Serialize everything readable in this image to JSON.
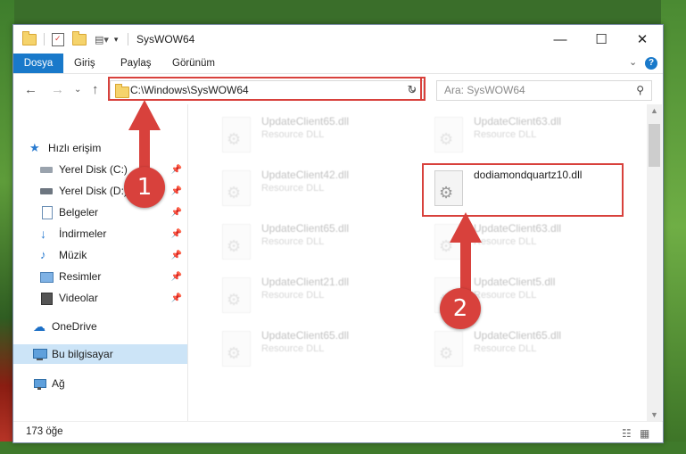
{
  "window": {
    "title": "SysWOW64",
    "min": "—",
    "max": "☐",
    "close": "✕"
  },
  "ribbon": {
    "tabs": [
      {
        "label": "Dosya",
        "active": true
      },
      {
        "label": "Giriş"
      },
      {
        "label": "Paylaş"
      },
      {
        "label": "Görünüm"
      }
    ],
    "expand": "⌄",
    "help": "?"
  },
  "address": {
    "path": "C:\\Windows\\SysWOW64",
    "dropdown": "⌄",
    "refresh": "↻",
    "search_placeholder": "Ara: SysWOW64"
  },
  "nav": {
    "back": "←",
    "forward": "→",
    "recent": "⌄",
    "up": "↑"
  },
  "sidebar": {
    "quick_access": "Hızlı erişim",
    "items": [
      {
        "label": "Yerel Disk (C:)",
        "pinned": true
      },
      {
        "label": "Yerel Disk (D:)",
        "pinned": true
      },
      {
        "label": "Belgeler",
        "pinned": true
      },
      {
        "label": "İndirmeler",
        "pinned": true
      },
      {
        "label": "Müzik",
        "pinned": true
      },
      {
        "label": "Resimler",
        "pinned": true
      },
      {
        "label": "Videolar",
        "pinned": true
      }
    ],
    "onedrive": "OneDrive",
    "this_pc": "Bu bilgisayar",
    "network": "Ağ"
  },
  "files": [
    {
      "name": "UpdateClient65.dll",
      "type": "Resource DLL",
      "faded": true
    },
    {
      "name": "UpdateClient63.dll",
      "type": "Resource DLL",
      "faded": true
    },
    {
      "name": "UpdateClient42.dll",
      "type": "Resource DLL",
      "faded": true
    },
    {
      "name": "dodiamondquartz10.dll",
      "type": "",
      "faded": false
    },
    {
      "name": "UpdateClient65.dll",
      "type": "Resource DLL",
      "faded": true
    },
    {
      "name": "UpdateClient63.dll",
      "type": "Resource DLL",
      "faded": true
    },
    {
      "name": "UpdateClient21.dll",
      "type": "Resource DLL",
      "faded": true
    },
    {
      "name": "UpdateClient5.dll",
      "type": "Resource DLL",
      "faded": true
    },
    {
      "name": "UpdateClient65.dll",
      "type": "Resource DLL",
      "faded": true
    },
    {
      "name": "UpdateClient65.dll",
      "type": "Resource DLL",
      "faded": true
    }
  ],
  "status": {
    "count": "173 öğe"
  },
  "callouts": {
    "one": "1",
    "two": "2",
    "color": "#d8413c"
  }
}
